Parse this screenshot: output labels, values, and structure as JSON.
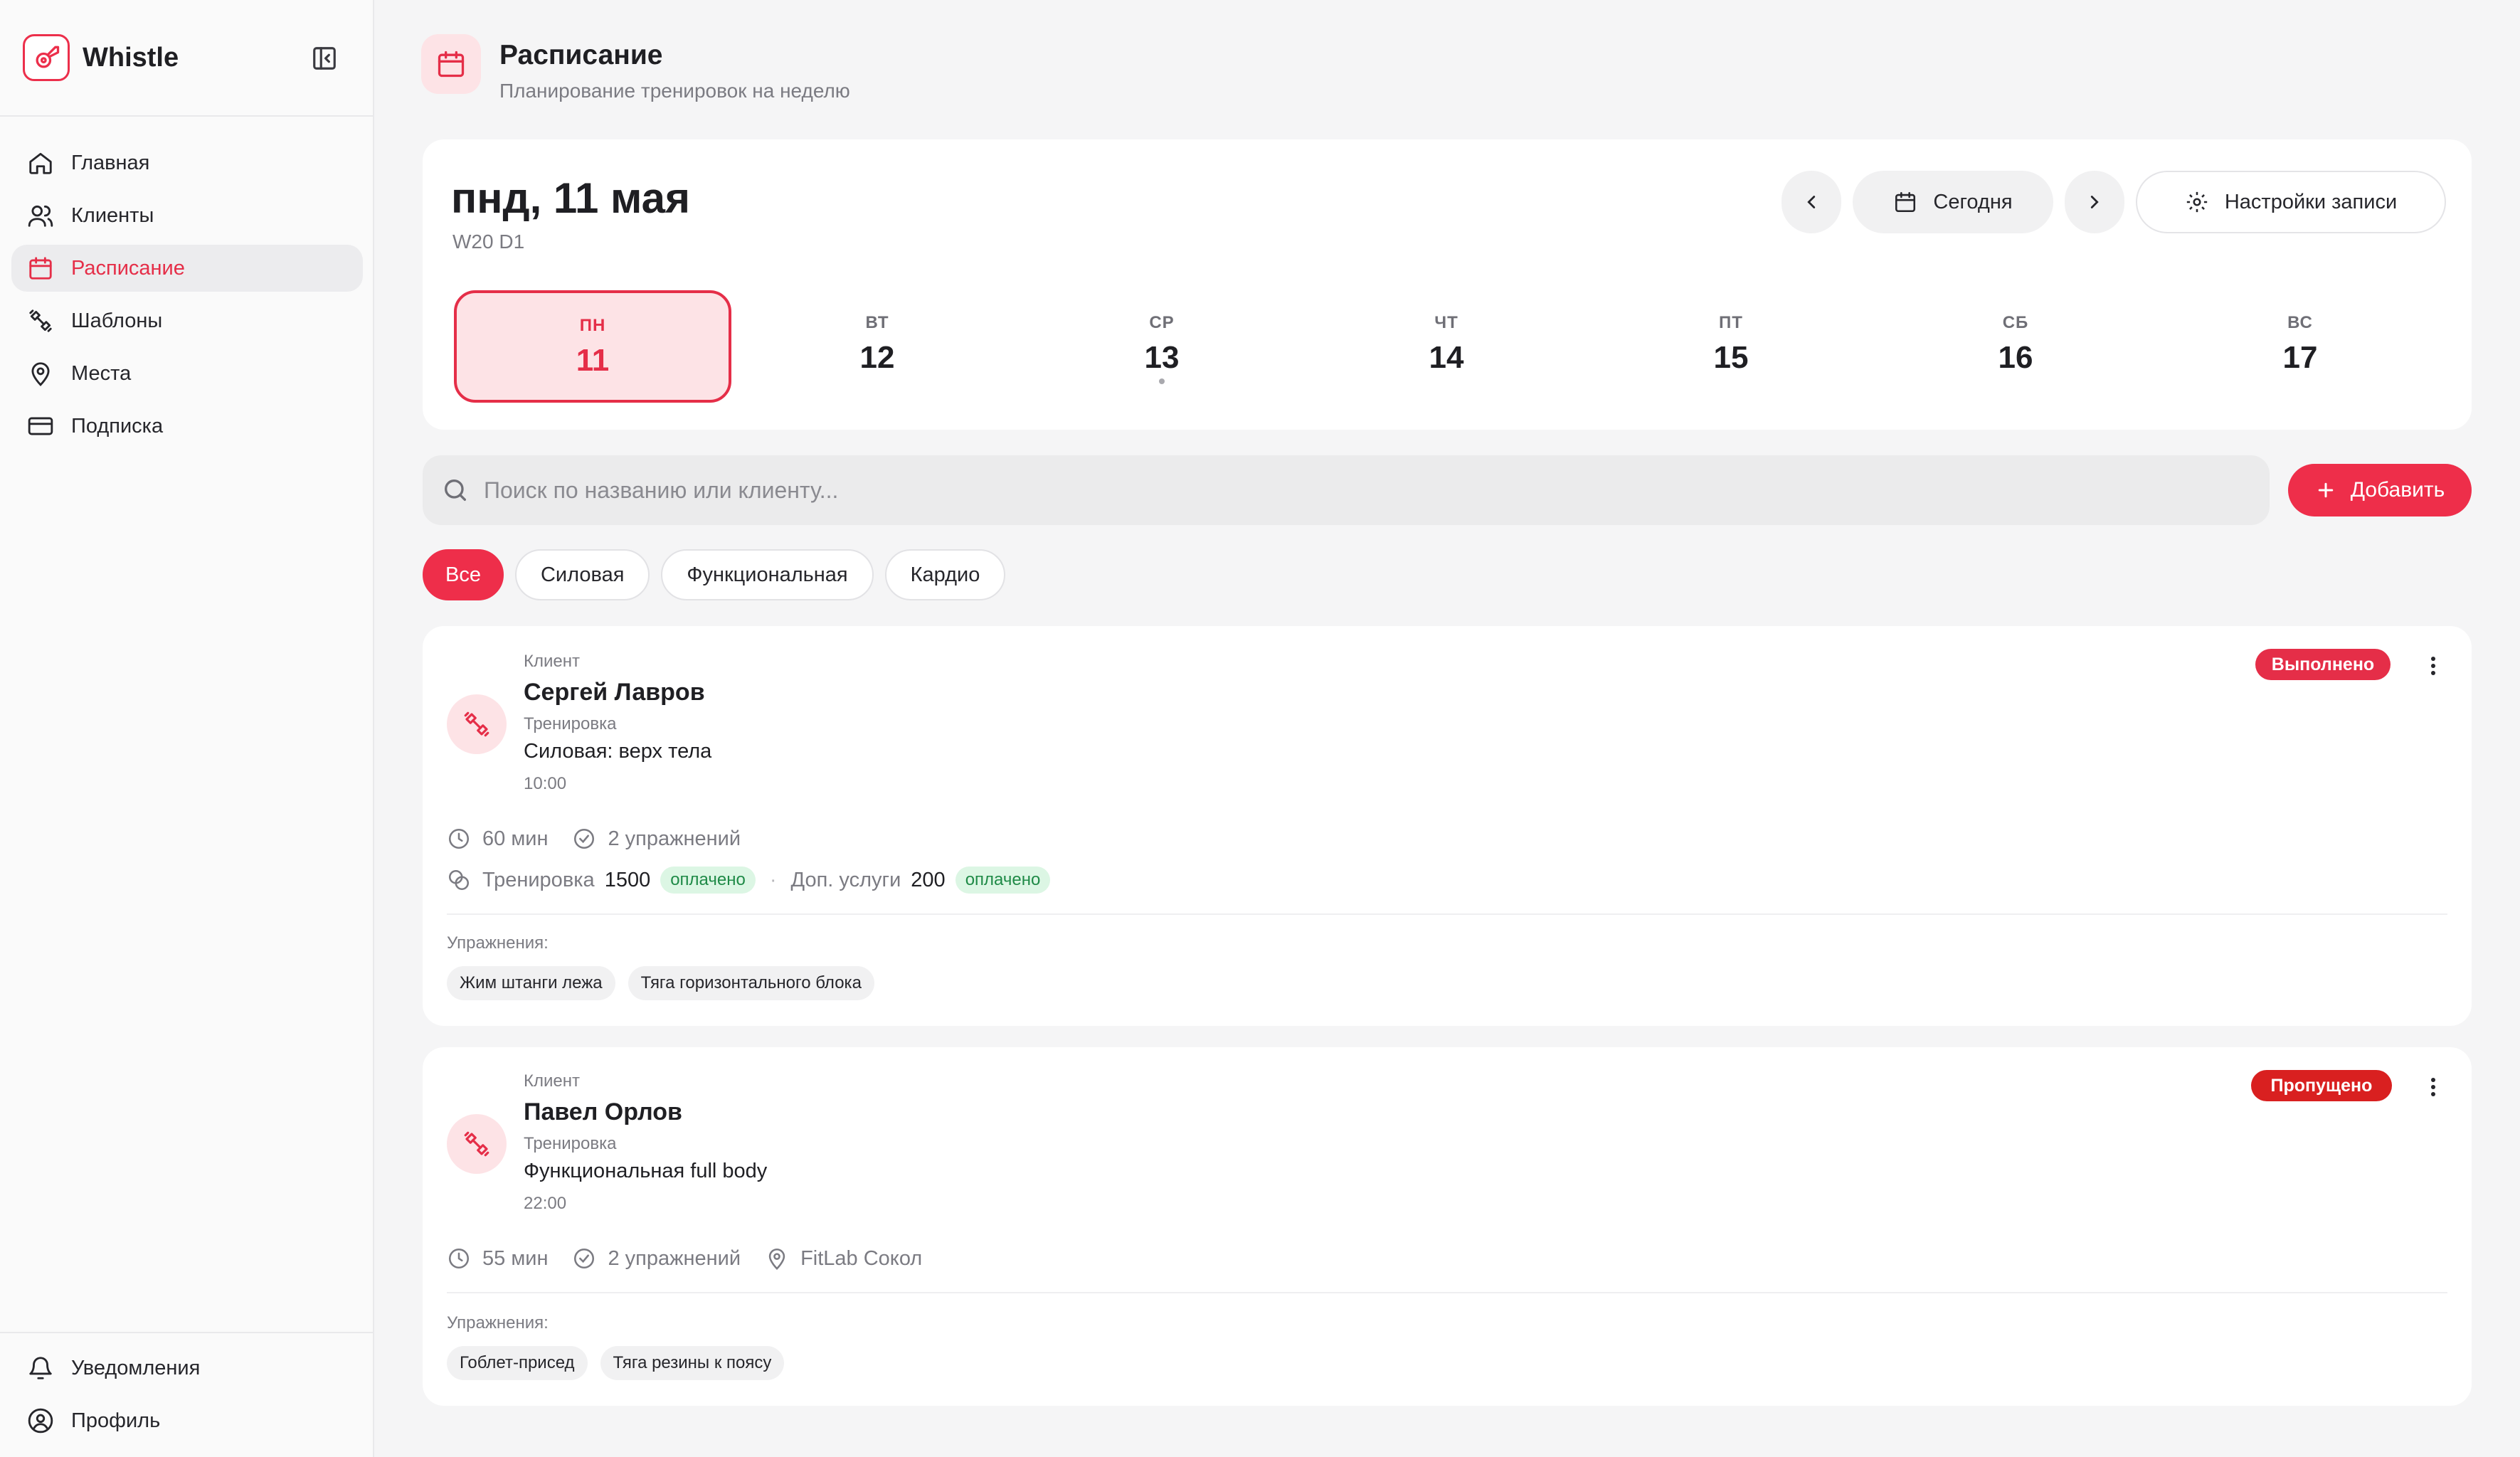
{
  "app": {
    "name": "Whistle"
  },
  "sidebar": {
    "items": [
      {
        "label": "Главная",
        "icon": "home-icon"
      },
      {
        "label": "Клиенты",
        "icon": "users-icon"
      },
      {
        "label": "Расписание",
        "icon": "calendar-icon",
        "active": true
      },
      {
        "label": "Шаблоны",
        "icon": "dumbbell-icon"
      },
      {
        "label": "Места",
        "icon": "map-pin-icon"
      },
      {
        "label": "Подписка",
        "icon": "credit-card-icon"
      }
    ],
    "bottom_items": [
      {
        "label": "Уведомления",
        "icon": "bell-icon"
      },
      {
        "label": "Профиль",
        "icon": "user-circle-icon"
      }
    ]
  },
  "header": {
    "title": "Расписание",
    "subtitle": "Планирование тренировок на неделю"
  },
  "calendar": {
    "selected_date": "пнд, 11 мая",
    "week_code": "W20 D1",
    "today_label": "Сегодня",
    "settings_label": "Настройки записи",
    "days": [
      {
        "name": "ПН",
        "num": "11",
        "active": true,
        "has_event": false
      },
      {
        "name": "ВТ",
        "num": "12",
        "active": false,
        "has_event": false
      },
      {
        "name": "СР",
        "num": "13",
        "active": false,
        "has_event": true
      },
      {
        "name": "ЧТ",
        "num": "14",
        "active": false,
        "has_event": false
      },
      {
        "name": "ПТ",
        "num": "15",
        "active": false,
        "has_event": false
      },
      {
        "name": "СБ",
        "num": "16",
        "active": false,
        "has_event": false
      },
      {
        "name": "ВС",
        "num": "17",
        "active": false,
        "has_event": false
      }
    ]
  },
  "search": {
    "placeholder": "Поиск по названию или клиенту..."
  },
  "add_button": {
    "label": "Добавить"
  },
  "filters": [
    "Все",
    "Силовая",
    "Функциональная",
    "Кардио"
  ],
  "sessions": [
    {
      "client_label": "Клиент",
      "client": "Сергей Лавров",
      "workout_label": "Тренировка",
      "workout": "Силовая: верх тела",
      "time": "10:00",
      "status": "Выполнено",
      "duration": "60 мин",
      "exercises_count": "2 упражнений",
      "price_label": "Тренировка",
      "price": "1500",
      "price_status": "оплачено",
      "extra_label": "Доп. услуги",
      "extra": "200",
      "extra_status": "оплачено",
      "exercises_label": "Упражнения:",
      "exercises": [
        "Жим штанги лежа",
        "Тяга горизонтального блока"
      ]
    },
    {
      "client_label": "Клиент",
      "client": "Павел Орлов",
      "workout_label": "Тренировка",
      "workout": "Функциональная full body",
      "time": "22:00",
      "status": "Пропущено",
      "duration": "55 мин",
      "exercises_count": "2 упражнений",
      "location": "FitLab Сокол",
      "exercises_label": "Упражнения:",
      "exercises": [
        "Гоблет-присед",
        "Тяга резины к поясу"
      ]
    }
  ],
  "colors": {
    "accent": "#ee2e4a",
    "accent_soft": "#fde3e6",
    "status_done": "#e52e48",
    "status_missed": "#d92020",
    "paid_bg": "#dcf6e4",
    "paid_text": "#1f8a47"
  }
}
